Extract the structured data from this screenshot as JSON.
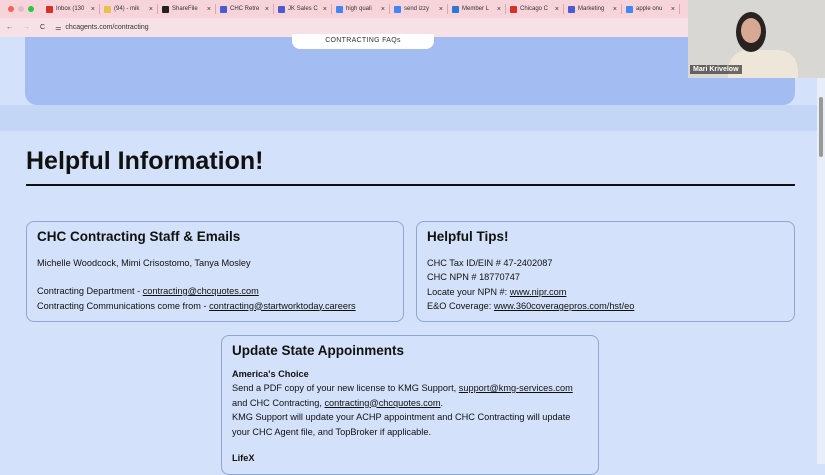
{
  "browser": {
    "tabs": [
      {
        "label": "Inbox (130",
        "color": "#d93025"
      },
      {
        "label": "(94) - mik",
        "color": "#e8c14a"
      },
      {
        "label": "ShareFile",
        "color": "#222"
      },
      {
        "label": "CHC Retre",
        "color": "#4a5ad0"
      },
      {
        "label": "JK Sales C",
        "color": "#4a5ad0"
      },
      {
        "label": "high quali",
        "color": "#4285f4"
      },
      {
        "label": "send izzy",
        "color": "#4285f4"
      },
      {
        "label": "Member L",
        "color": "#2a7ad0"
      },
      {
        "label": "Chicago C",
        "color": "#d93025"
      },
      {
        "label": "Marketing",
        "color": "#4a5ad0"
      },
      {
        "label": "apple onu",
        "color": "#4285f4"
      }
    ],
    "url": "chcagents.com/contracting"
  },
  "page": {
    "faq_button": "CONTRACTING FAQs",
    "heading": "Helpful Information!",
    "staff_card": {
      "title": "CHC Contracting Staff & Emails",
      "names": "Michelle Woodcock, Mimi Crisostomo, Tanya Mosley",
      "dept_label": "Contracting Department - ",
      "dept_email": "contracting@chcquotes.com",
      "comm_label": "Contracting Communications come from - ",
      "comm_email": "contracting@startworktoday.careers"
    },
    "tips_card": {
      "title": "Helpful Tips!",
      "tax_id": "CHC Tax ID/EIN # 47-2402087",
      "npn": "CHC NPN # 18770747",
      "locate_label": "Locate your NPN #: ",
      "locate_link": "www.nipr.com",
      "eo_label": "E&O Coverage: ",
      "eo_link": "www.360coveragepros.com/hst/eo"
    },
    "state_card": {
      "title": "Update State Appoinments",
      "sub1": "America's Choice",
      "line1": "Send a PDF copy of your new license to KMG Support, ",
      "link1": "support@kmg-services.com",
      "line2": " and CHC Contracting, ",
      "link2": "contracting@chcquotes.com",
      "line2_end": ".",
      "line3": "KMG Support will update your ACHP appointment and CHC Contracting will update your CHC Agent file, and TopBroker if applicable.",
      "sub2": "LifeX"
    }
  },
  "video": {
    "participant": "Mari Krivelow"
  }
}
